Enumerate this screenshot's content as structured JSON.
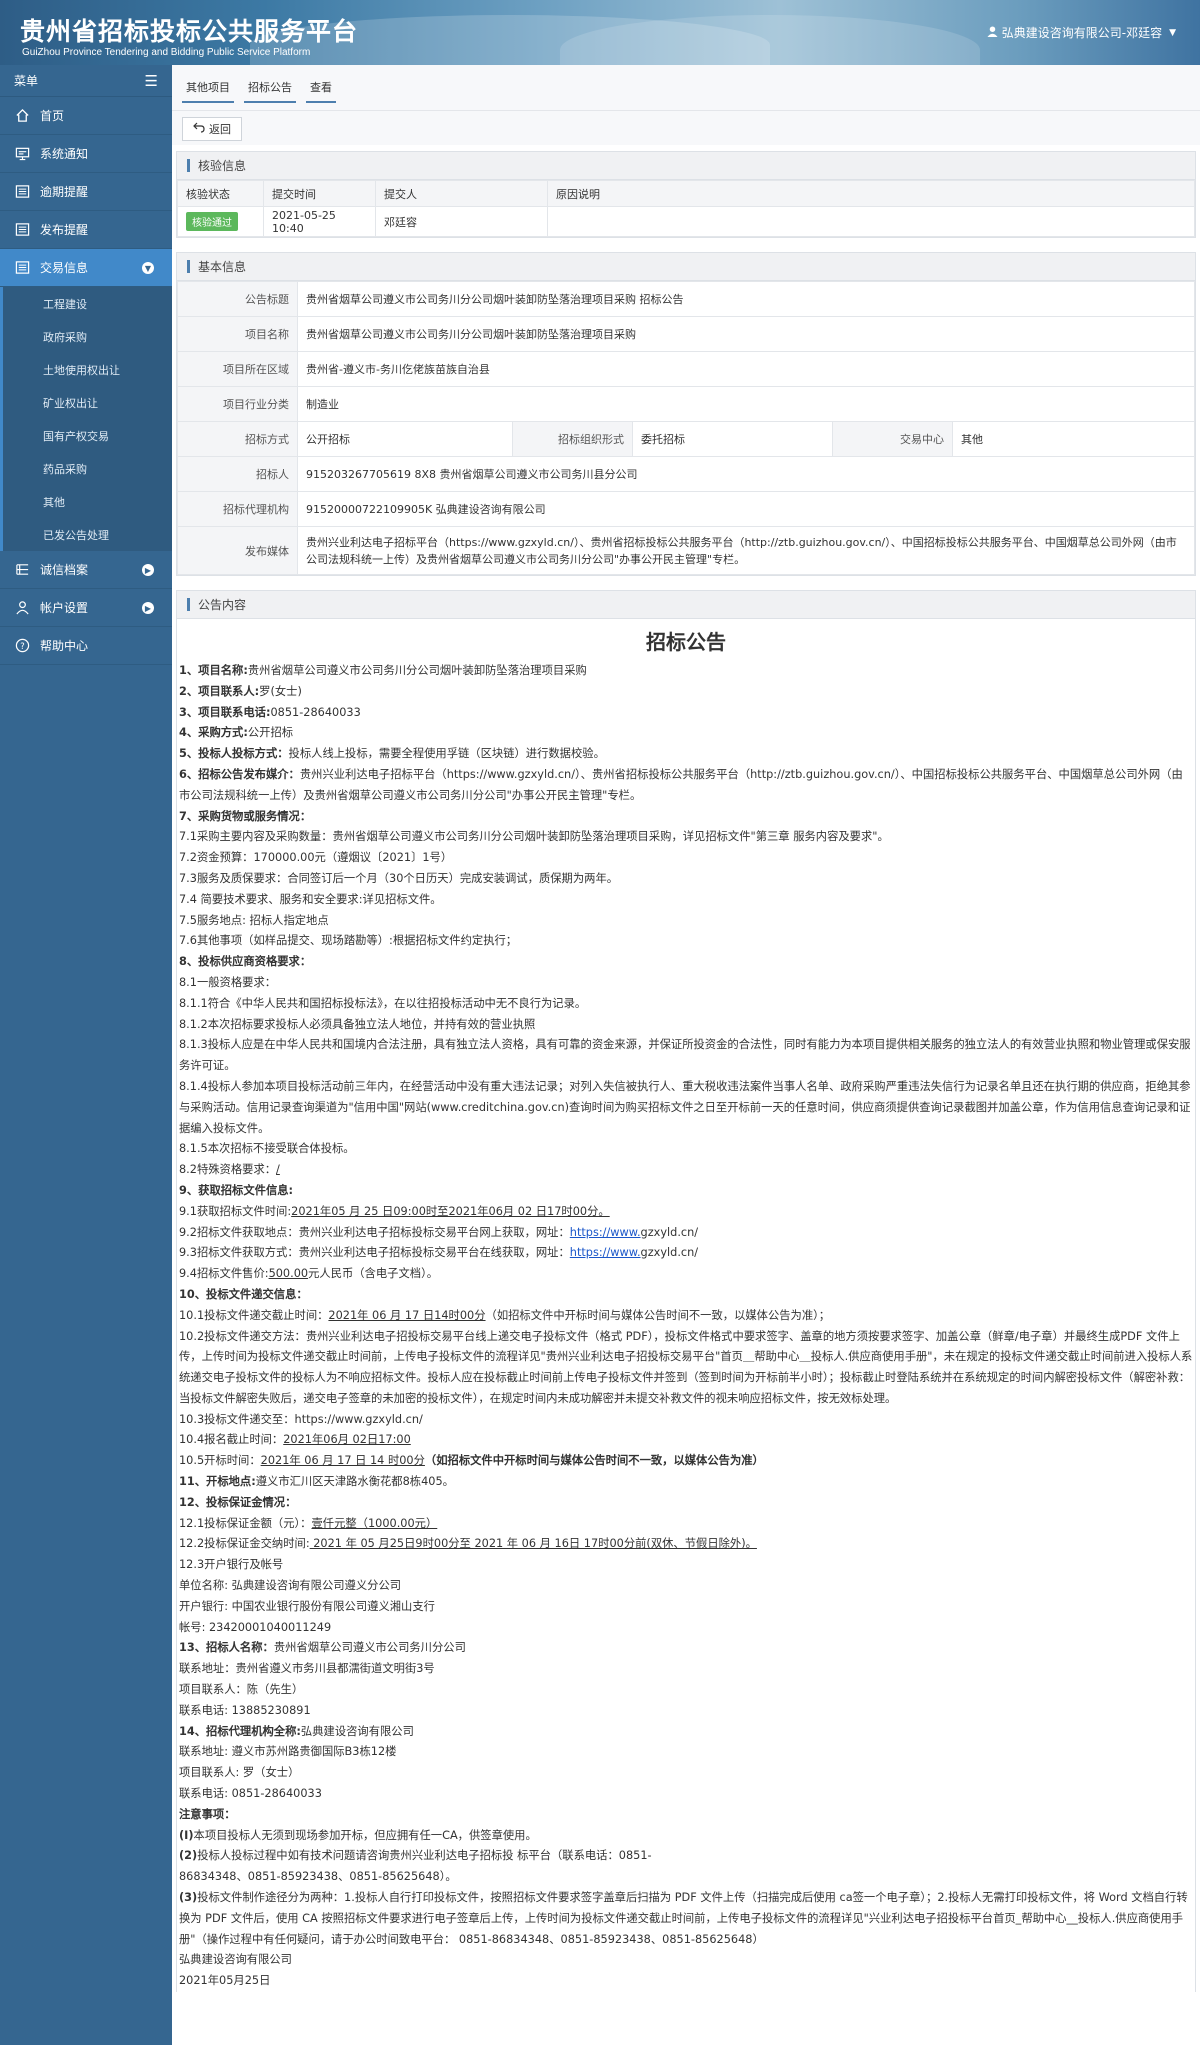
{
  "header": {
    "title_cn": "贵州省招标投标公共服务平台",
    "title_en": "GuiZhou Province Tendering and Bidding Public Service Platform",
    "user": "弘典建设咨询有限公司-邓廷容"
  },
  "sidebar": {
    "menu_label": "菜单",
    "items": [
      {
        "label": "首页",
        "icon": "home-icon"
      },
      {
        "label": "系统通知",
        "icon": "monitor-icon"
      },
      {
        "label": "逾期提醒",
        "icon": "list-icon"
      },
      {
        "label": "发布提醒",
        "icon": "list-icon"
      },
      {
        "label": "交易信息",
        "icon": "list-icon"
      }
    ],
    "sub_items": [
      "工程建设",
      "政府采购",
      "土地使用权出让",
      "矿业权出让",
      "国有产权交易",
      "药品采购",
      "其他",
      "已发公告处理"
    ],
    "bottom_items": [
      {
        "label": "诚信档案",
        "icon": "list-icon"
      },
      {
        "label": "帐户设置",
        "icon": "user-icon"
      },
      {
        "label": "帮助中心",
        "icon": "help-icon"
      }
    ]
  },
  "breadcrumb": [
    "其他项目",
    "招标公告",
    "查看"
  ],
  "toolbar": {
    "back_label": "返回"
  },
  "verify": {
    "section_title": "核验信息",
    "headers": [
      "核验状态",
      "提交时间",
      "提交人",
      "原因说明"
    ],
    "row": {
      "status": "核验通过",
      "time": "2021-05-25 10:40",
      "submitter": "邓廷容",
      "reason": ""
    }
  },
  "basic": {
    "section_title": "基本信息",
    "notice_title_label": "公告标题",
    "notice_title": "贵州省烟草公司遵义市公司务川分公司烟叶装卸防坠落治理项目采购 招标公告",
    "project_name_label": "项目名称",
    "project_name": "贵州省烟草公司遵义市公司务川分公司烟叶装卸防坠落治理项目采购",
    "region_label": "项目所在区域",
    "region": "贵州省-遵义市-务川仡佬族苗族自治县",
    "industry_label": "项目行业分类",
    "industry": "制造业",
    "method_label": "招标方式",
    "method": "公开招标",
    "org_form_label": "招标组织形式",
    "org_form": "委托招标",
    "center_label": "交易中心",
    "center": "其他",
    "tenderer_label": "招标人",
    "tenderer": "915203267705619 8X8 贵州省烟草公司遵义市公司务川县分公司",
    "agency_label": "招标代理机构",
    "agency": "91520000722109905K 弘典建设咨询有限公司",
    "media_label": "发布媒体",
    "media": "贵州兴业利达电子招标平台（https://www.gzxyld.cn/）、贵州省招标投标公共服务平台（http://ztb.guizhou.gov.cn/）、中国招标投标公共服务平台、中国烟草总公司外网（由市公司法规科统一上传）及贵州省烟草公司遵义市公司务川分公司\"办事公开民主管理\"专栏。"
  },
  "content": {
    "section_title": "公告内容",
    "title": "招标公告",
    "l1a": "1、项目名称:",
    "l1b": "贵州省烟草公司遵义市公司务川分公司烟叶装卸防坠落治理项目采购",
    "l2a": "2、项目联系人:",
    "l2b": "罗(女士)",
    "l3a": "3、项目联系电话:",
    "l3b": "0851-28640033",
    "l4a": "4、采购方式:",
    "l4b": "公开招标",
    "l5a": "5、投标人投标方式：",
    "l5b": "投标人线上投标，需要全程使用孚链（区块链）进行数据校验。",
    "l6a": "6、招标公告发布媒介：",
    "l6b": "贵州兴业利达电子招标平台（https://www.gzxyld.cn/）、贵州省招标投标公共服务平台（http://ztb.guizhou.gov.cn/）、中国招标投标公共服务平台、中国烟草总公司外网（由市公司法规科统一上传）及贵州省烟草公司遵义市公司务川分公司\"办事公开民主管理\"专栏。",
    "l7": "7、采购货物或服务情况：",
    "l7_1": "7.1采购主要内容及采购数量：贵州省烟草公司遵义市公司务川分公司烟叶装卸防坠落治理项目采购，详见招标文件\"第三章 服务内容及要求\"。",
    "l7_2": "7.2资金预算：170000.00元（遵烟议〔2021〕1号）",
    "l7_3": "7.3服务及质保要求：合同签订后一个月（30个日历天）完成安装调试，质保期为两年。",
    "l7_4": "7.4 简要技术要求、服务和安全要求:详见招标文件。",
    "l7_5": "7.5服务地点: 招标人指定地点",
    "l7_6": "7.6其他事项（如样品提交、现场踏勘等）:根据招标文件约定执行；",
    "l8": "8、投标供应商资格要求：",
    "l8_1": "8.1一般资格要求：",
    "l8_1_1": "8.1.1符合《中华人民共和国招标投标法》，在以往招投标活动中无不良行为记录。",
    "l8_1_2": "8.1.2本次招标要求投标人必须具备独立法人地位，并持有效的营业执照",
    "l8_1_3": "8.1.3投标人应是在中华人民共和国境内合法注册，具有独立法人资格，具有可靠的资金来源，并保证所投资金的合法性，同时有能力为本项目提供相关服务的独立法人的有效营业执照和物业管理或保安服务许可证。",
    "l8_1_4": "8.1.4投标人参加本项目投标活动前三年内，在经营活动中没有重大违法记录；对列入失信被执行人、重大税收违法案件当事人名单、政府采购严重违法失信行为记录名单且还在执行期的供应商，拒绝其参与采购活动。信用记录查询渠道为\"信用中国\"网站(www.creditchina.gov.cn)查询时间为购买招标文件之日至开标前一天的任意时间，供应商须提供查询记录截图并加盖公章，作为信用信息查询记录和证据编入投标文件。",
    "l8_1_5": "8.1.5本次招标不接受联合体投标。",
    "l8_2a": "8.2特殊资格要求：",
    "l8_2b": "/",
    "l9": "9、获取招标文件信息:",
    "l9_1a": "9.1获取招标文件时间:",
    "l9_1b": "2021年05 月 25 日09:00时至2021年06月 02 日17时00分。",
    "l9_2a": "9.2招标文件获取地点：贵州兴业利达电子招标投标交易平台网上获取，网址：",
    "l9_2b": "https://www.",
    "l9_2c": "gzxyld.cn/",
    "l9_3a": "9.3招标文件获取方式：贵州兴业利达电子招标投标交易平台在线获取，网址：",
    "l9_3b": "https://www.",
    "l9_3c": "gzxyld.cn/",
    "l9_4a": "9.4招标文件售价:",
    "l9_4b": "500.00",
    "l9_4c": "元人民币（含电子文档）。",
    "l10": "10、投标文件递交信息：",
    "l10_1a": "10.1投标文件递交截止时间：",
    "l10_1b": "2021年 06 月 17 日14时00分",
    "l10_1c": "（如招标文件中开标时间与媒体公告时间不一致，以媒体公告为准）；",
    "l10_2": "10.2投标文件递交方法：贵州兴业利达电子招投标交易平台线上递交电子投标文件（格式 PDF），投标文件格式中要求签字、盖章的地方须按要求签字、加盖公章（鲜章/电子章）并最终生成PDF 文件上传，上传时间为投标文件递交截止时间前，上传电子投标文件的流程详见\"贵州兴业利达电子招投标交易平台\"首页＿帮助中心＿投标人.供应商使用手册\"，未在规定的投标文件递交截止时间前进入投标人系统递交电子投标文件的投标人为不响应招标文件。投标人应在投标截止时间前上传电子投标文件并签到（签到时间为开标前半小时）；投标截止时登陆系统并在系统规定的时间内解密投标文件（解密补救：当投标文件解密失败后，递交电子签章的未加密的投标文件），在规定时间内未成功解密并未提交补救文件的视未响应招标文件，按无效标处理。",
    "l10_3": "10.3投标文件递交至：https://www.gzxyld.cn/",
    "l10_4a": "10.4报名截止时间：",
    "l10_4b": "2021年06月 02日17:00",
    "l10_5a": "10.5开标时间：",
    "l10_5b": "2021年 06 月 17 日 14 时00分",
    "l10_5c": "（如招标文件中开标时间与媒体公告时间不一致，以媒体公告为准）",
    "l11a": "11、开标地点:",
    "l11b": "遵义市汇川区天津路水衡花都8栋405。",
    "l12": "12、投标保证金情况：",
    "l12_1a": "12.1投标保证金额（元）：",
    "l12_1b": "壹仟元整（1000.00元）",
    "l12_2a": "12.2投标保证金交纳时间:",
    "l12_2b": " 2021 年 05 月25日9时00分至 2021 年 06 月 16日 17时00分前(双休、节假日除外)。",
    "l12_3": "12.3开户银行及帐号",
    "acct_name": "单位名称: 弘典建设咨询有限公司遵义分公司",
    "acct_bank": "开户银行: 中国农业银行股份有限公司遵义湘山支行",
    "acct_no": "帐号: 23420001040011249",
    "l13a": "13、招标人名称：",
    "l13b": "贵州省烟草公司遵义市公司务川分公司",
    "t_addr": "联系地址：贵州省遵义市务川县都濡街道文明街3号",
    "t_contact": "项目联系人：陈（先生）",
    "t_phone": "联系电话: 13885230891",
    "l14a": "14、招标代理机构全称:",
    "l14b": "弘典建设咨询有限公司",
    "a_addr": "联系地址: 遵义市苏州路贵御国际B3栋12楼",
    "a_contact": "项目联系人: 罗（女士）",
    "a_phone": "联系电话: 0851-28640033",
    "note_title": "注意事项：",
    "n1a": "(I)",
    "n1b": "本项目投标人无须到现场参加开标，但应拥有任一CA，供签章使用。",
    "n2a": "(2)",
    "n2b": "投标人投标过程中如有技术问题请咨询贵州兴业利达电子招标投 标平台（联系电话：0851-",
    "n2c": "86834348、0851-85923438、0851-85625648）。",
    "n3a": "(3)",
    "n3b": "投标文件制作途径分为两种：1.投标人自行打印投标文件，按照招标文件要求签字盖章后扫描为 PDF 文件上传（扫描完成后使用 ca签一个电子章）；2.投标人无需打印投标文件，将 Word 文档自行转换为 PDF 文件后，使用 CA 按照招标文件要求进行电子签章后上传，上传时间为投标文件递交截止时间前，上传电子投标文件的流程详见\"兴业利达电子招投标平台首页_帮助中心__投标人.供应商使用手册\"（操作过程中有任何疑问，请于办公时间致电平台： 0851-86834348、0851-85923438、0851-85625648）",
    "sig_org": "弘典建设咨询有限公司",
    "sig_date": "2021年05月25日"
  }
}
